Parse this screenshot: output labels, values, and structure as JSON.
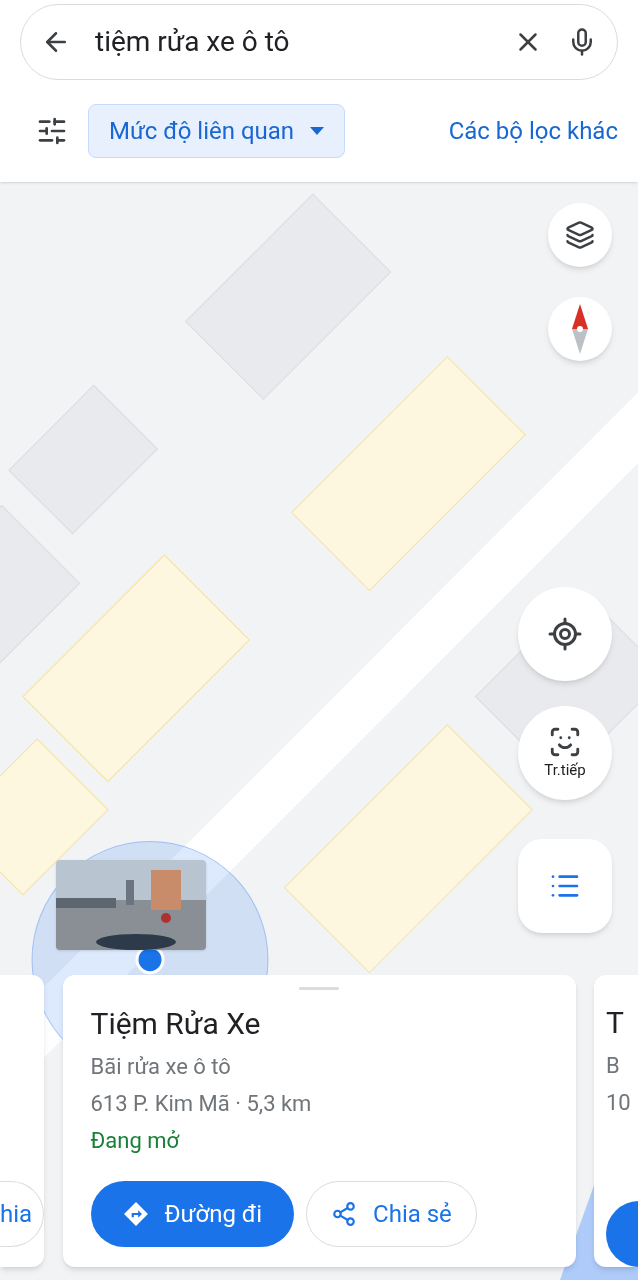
{
  "search": {
    "value": "tiệm rửa xe ô tô"
  },
  "filters": {
    "chip": {
      "label": "Mức độ liên quan",
      "selected": true
    },
    "more": "Các bộ lọc khác"
  },
  "map": {
    "kind": "picture",
    "live_view_label": "Tr.tiếp"
  },
  "cards": [
    {
      "kind": "left",
      "share_label": "hia"
    },
    {
      "kind": "main",
      "title": "Tiệm Rửa Xe",
      "category": "Bãi rửa xe ô tô",
      "address": "613 P. Kim Mã · 5,3 km",
      "status": "Đang mở",
      "directions": "Đường đi",
      "share": "Chia sẻ"
    },
    {
      "kind": "right",
      "title": "T",
      "category": "B",
      "address": "10"
    }
  ]
}
